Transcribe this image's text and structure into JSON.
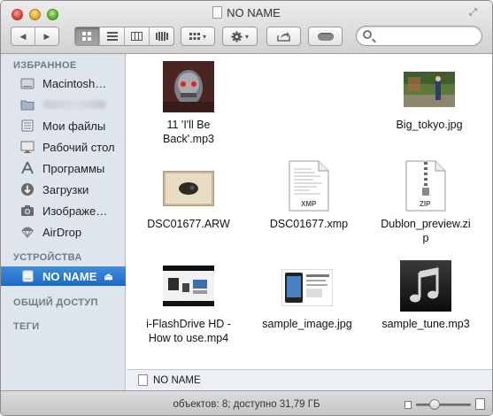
{
  "window": {
    "title": "NO NAME"
  },
  "toolbar": {
    "back_label": "◀",
    "forward_label": "▶",
    "arrange_label": "▾",
    "action_label": "▾",
    "search": {
      "placeholder": "",
      "value": ""
    }
  },
  "sidebar": {
    "favorites_header": "ИЗБРАННОЕ",
    "devices_header": "УСТРОЙСТВА",
    "shared_header": "ОБЩИЙ ДОСТУП",
    "tags_header": "ТЕГИ",
    "favorites": [
      {
        "label": "Macintosh…",
        "icon": "hard-drive-icon"
      },
      {
        "label": "",
        "icon": "folder-icon"
      },
      {
        "label": "Мои файлы",
        "icon": "all-files-icon"
      },
      {
        "label": "Рабочий стол",
        "icon": "desktop-icon"
      },
      {
        "label": "Программы",
        "icon": "applications-icon"
      },
      {
        "label": "Загрузки",
        "icon": "downloads-icon"
      },
      {
        "label": "Изображе…",
        "icon": "camera-icon"
      },
      {
        "label": "AirDrop",
        "icon": "airdrop-icon"
      }
    ],
    "devices": [
      {
        "label": "NO NAME",
        "icon": "external-drive-icon",
        "selected": true
      }
    ]
  },
  "files": [
    {
      "name": "11 'I'll Be Back'.mp3",
      "line1": "11 'I'll Be",
      "line2": "Back'.mp3",
      "kind": "album-art"
    },
    {
      "name": "Big_tokyo.jpg",
      "line1": "Big_tokyo.jpg",
      "line2": "",
      "kind": "photo"
    },
    {
      "name": "DSC01677.ARW",
      "line1": "DSC01677.ARW",
      "line2": "",
      "kind": "photo"
    },
    {
      "name": "DSC01677.xmp",
      "line1": "DSC01677.xmp",
      "line2": "",
      "kind": "document",
      "badge": "XMP"
    },
    {
      "name": "Dublon_preview.zip",
      "line1": "Dublon_preview.zi",
      "line2": "p",
      "kind": "archive",
      "badge": "ZIP"
    },
    {
      "name": "i-FlashDrive HD - How to use.mp4",
      "line1": "i-FlashDrive HD -",
      "line2": "How to use.mp4",
      "kind": "video"
    },
    {
      "name": "sample_image.jpg",
      "line1": "sample_image.jpg",
      "line2": "",
      "kind": "photo"
    },
    {
      "name": "sample_tune.mp3",
      "line1": "sample_tune.mp3",
      "line2": "",
      "kind": "music"
    }
  ],
  "pathbar": {
    "label": "NO NAME"
  },
  "status": {
    "text": "объектов: 8; доступно 31,79 ГБ"
  },
  "zoom": {
    "level": 0.3
  },
  "colors": {
    "selection": "#1c69c4",
    "sidebar_bg": "#dfe5ed",
    "sidebar_header": "#717b87"
  }
}
